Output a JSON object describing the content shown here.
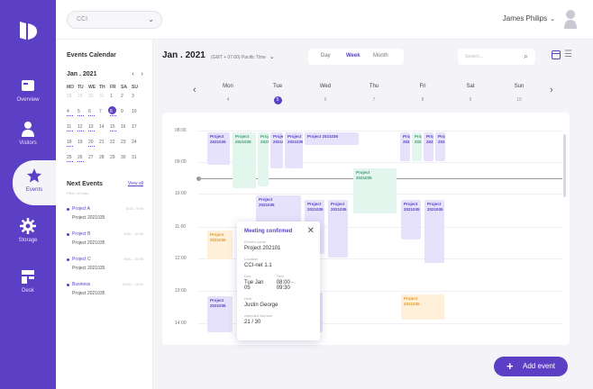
{
  "workspace": {
    "selected": "CCI"
  },
  "user": {
    "name": "James Philips"
  },
  "nav": [
    {
      "label": "Overview",
      "icon": "overview-icon"
    },
    {
      "label": "Visitors",
      "icon": "visitors-icon"
    },
    {
      "label": "Events",
      "icon": "events-icon",
      "active": true
    },
    {
      "label": "Storage",
      "icon": "storage-icon"
    },
    {
      "label": "Desk",
      "icon": "desk-icon"
    }
  ],
  "left_panel": {
    "title": "Events Calendar",
    "month_label": "Jan . 2021",
    "weekdays": [
      "MO",
      "TU",
      "WE",
      "TH",
      "FR",
      "SA",
      "SU"
    ],
    "days": [
      {
        "n": "28",
        "m": true
      },
      {
        "n": "29",
        "m": true
      },
      {
        "n": "30",
        "m": true
      },
      {
        "n": "31",
        "m": true
      },
      {
        "n": "1"
      },
      {
        "n": "2"
      },
      {
        "n": "3"
      },
      {
        "n": "4"
      },
      {
        "n": "5"
      },
      {
        "n": "6"
      },
      {
        "n": "7"
      },
      {
        "n": "8",
        "sel": true
      },
      {
        "n": "9"
      },
      {
        "n": "10"
      },
      {
        "n": "11"
      },
      {
        "n": "12"
      },
      {
        "n": "13"
      },
      {
        "n": "14"
      },
      {
        "n": "15"
      },
      {
        "n": "16"
      },
      {
        "n": "17"
      },
      {
        "n": "18"
      },
      {
        "n": "19"
      },
      {
        "n": "20"
      },
      {
        "n": "21"
      },
      {
        "n": "22"
      },
      {
        "n": "23"
      },
      {
        "n": "24"
      },
      {
        "n": "25"
      },
      {
        "n": "26"
      },
      {
        "n": "27"
      },
      {
        "n": "28"
      },
      {
        "n": "29"
      },
      {
        "n": "30"
      },
      {
        "n": "31"
      }
    ],
    "next_events_title": "Next Events",
    "view_all": "View all",
    "next_events_sub": "Filter: 10 max",
    "next_events": [
      {
        "name": "Project A",
        "time": "8:00 - 9:00",
        "desc": "Project 2021035"
      },
      {
        "name": "Project B",
        "time": "8:00 - 10:00",
        "desc": "Project 2021035"
      },
      {
        "name": "Project C",
        "time": "8:00 - 10:00",
        "desc": "Project 2021035"
      },
      {
        "name": "Business",
        "time": "10:00 - 11:00",
        "desc": "Project 2021035"
      }
    ]
  },
  "calendar": {
    "title": "Jan . 2021",
    "timezone": "(GMT + 07:00) Pacific Time",
    "views": [
      "Day",
      "Week",
      "Month"
    ],
    "active_view": "Week",
    "search_placeholder": "Search...",
    "days": [
      {
        "name": "Mon",
        "date": "4"
      },
      {
        "name": "Tue",
        "date": "5",
        "today": true
      },
      {
        "name": "Wed",
        "date": "6"
      },
      {
        "name": "Thu",
        "date": "7"
      },
      {
        "name": "Fri",
        "date": "8"
      },
      {
        "name": "Sat",
        "date": "9"
      },
      {
        "name": "Sun",
        "date": "10"
      }
    ],
    "hours": [
      "08:00",
      "09:00",
      "10:00",
      "11:00",
      "12:00",
      "13:00",
      "14:00"
    ],
    "event_label": "Project",
    "event_code": "2021035",
    "event_wide": "Project 2021035"
  },
  "popover": {
    "title": "Meeting confirmed",
    "event_name_label": "Event's name",
    "event_name": "Project 202101",
    "location_label": "Location",
    "location": "CCI-net 1.1",
    "day_label": "Day",
    "day": "Tue Jan 05",
    "time_label": "Time",
    "time": "08:00 - 09:30",
    "host_label": "Host",
    "host": "Justin George",
    "attended_label": "Attended Number",
    "attended": "21 / 30"
  },
  "add_event_label": "Add event"
}
